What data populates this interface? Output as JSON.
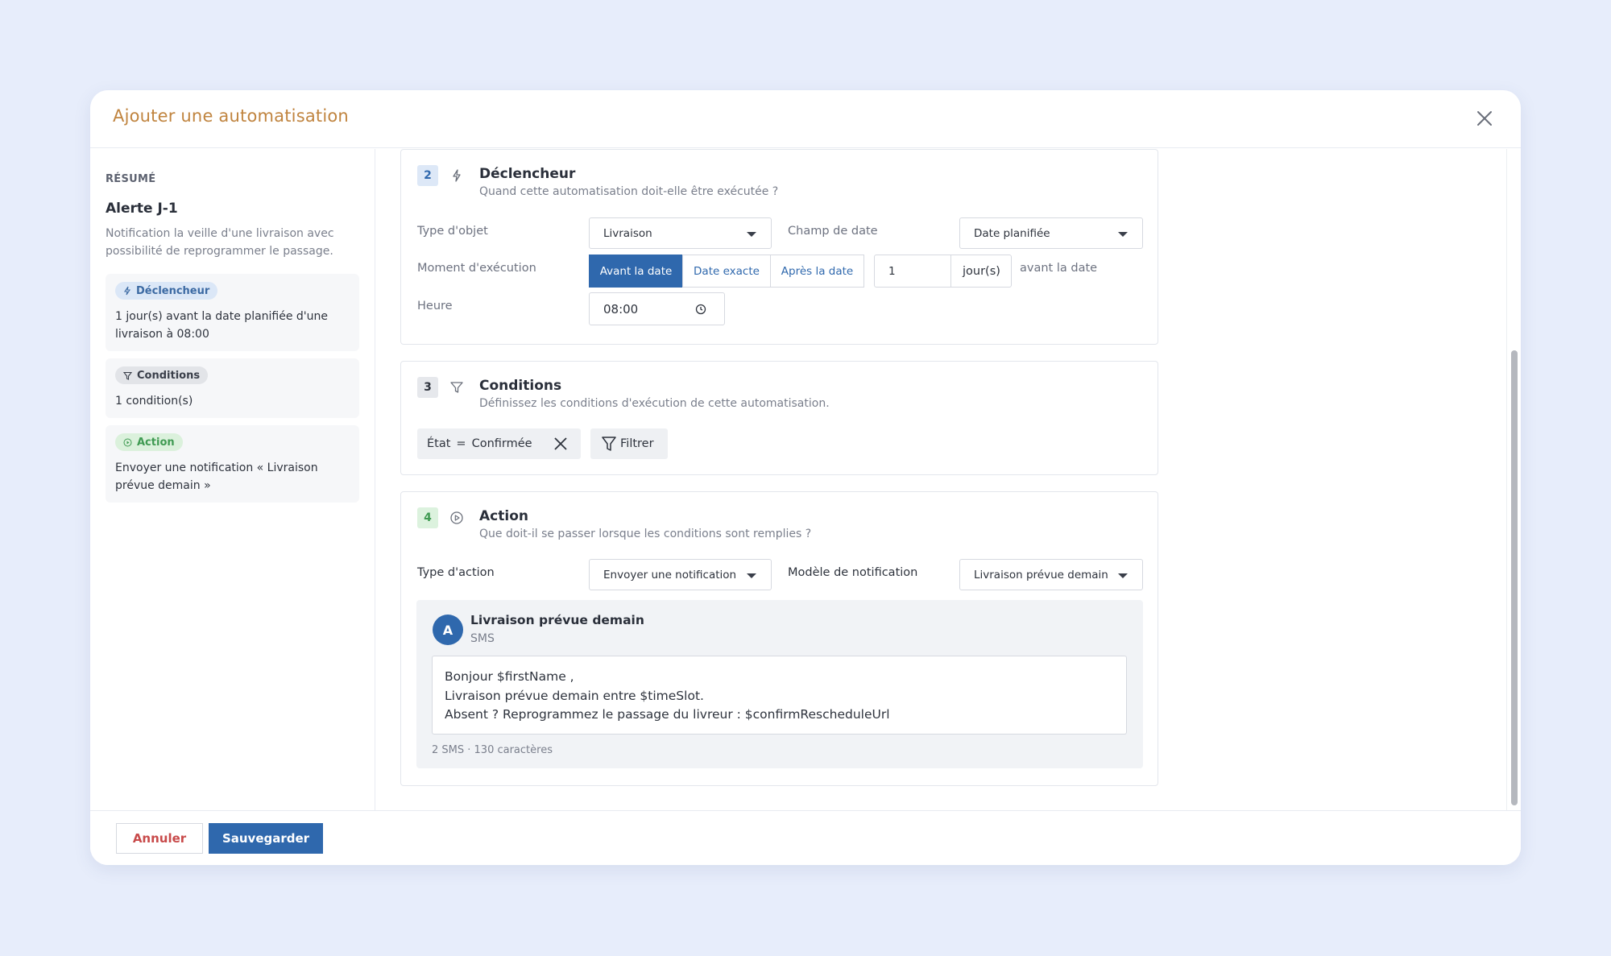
{
  "modal": {
    "title": "Ajouter une automatisation"
  },
  "summary": {
    "kicker": "RÉSUMÉ",
    "title": "Alerte J-1",
    "description": "Notification la veille d'une livraison avec possibilité de reprogrammer le passage.",
    "trigger_chip": "Déclencheur",
    "trigger_text": "1 jour(s) avant la date planifiée d'une livraison à 08:00",
    "conditions_chip": "Conditions",
    "conditions_text": "1 condition(s)",
    "action_chip": "Action",
    "action_text": "Envoyer une notification « Livraison prévue demain »"
  },
  "trigger": {
    "step": "2",
    "title": "Déclencheur",
    "subtitle": "Quand cette automatisation doit-elle être exécutée ?",
    "object_type_label": "Type d'objet",
    "object_type_value": "Livraison",
    "date_field_label": "Champ de date",
    "date_field_value": "Date planifiée",
    "moment_label": "Moment d'exécution",
    "moment_options": [
      "Avant la date",
      "Date exacte",
      "Après la date"
    ],
    "moment_selected": "Avant la date",
    "offset_value": "1",
    "offset_unit": "jour(s)",
    "offset_suffix": "avant la date",
    "time_label": "Heure",
    "time_value": "08:00"
  },
  "conditions": {
    "step": "3",
    "title": "Conditions",
    "subtitle": "Définissez les conditions d'exécution de cette automatisation.",
    "filter_field": "État",
    "filter_operator": "=",
    "filter_value": "Confirmée",
    "filter_button": "Filtrer"
  },
  "action": {
    "step": "4",
    "title": "Action",
    "subtitle": "Que doit-il se passer lorsque les conditions sont remplies ?",
    "action_type_label": "Type d'action",
    "action_type_value": "Envoyer une notification",
    "template_label": "Modèle de notification",
    "template_value": "Livraison prévue demain",
    "preview": {
      "avatar_letter": "A",
      "title": "Livraison prévue demain",
      "channel": "SMS",
      "lines": [
        "Bonjour $firstName ,",
        "Livraison prévue demain entre $timeSlot.",
        "Absent ? Reprogrammez le passage du livreur : $confirmRescheduleUrl"
      ],
      "count": "2 SMS · 130 caractères"
    }
  },
  "footer": {
    "cancel_label": "Annuler",
    "save_label": "Sauvegarder"
  },
  "colors": {
    "accent": "#2f68ad",
    "title": "#c0843f",
    "danger": "#c84a4a",
    "background": "#e7edfb"
  },
  "icons": {
    "close": "close-icon",
    "trigger": "lightning-icon",
    "conditions": "filter-icon",
    "action": "play-circle-icon",
    "clock": "clock-icon"
  }
}
